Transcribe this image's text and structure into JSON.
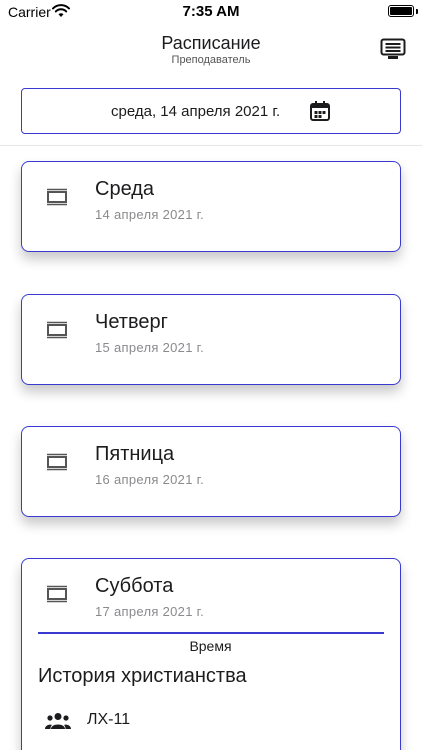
{
  "status_bar": {
    "carrier": "Carrier",
    "time": "7:35 AM"
  },
  "nav": {
    "title": "Расписание",
    "subtitle": "Преподаватель",
    "action_icon": "keyboard-icon"
  },
  "date_picker": {
    "value": "среда, 14 апреля 2021 г.",
    "icon": "calendar-icon"
  },
  "days": [
    {
      "name": "Среда",
      "date": "14 апреля 2021 г.",
      "icon": "collapse-icon"
    },
    {
      "name": "Четверг",
      "date": "15 апреля 2021 г.",
      "icon": "collapse-icon"
    },
    {
      "name": "Пятница",
      "date": "16 апреля 2021 г.",
      "icon": "collapse-icon"
    },
    {
      "name": "Суббота",
      "date": "17 апреля 2021 г.",
      "icon": "collapse-icon",
      "time_header": "Время",
      "lesson": {
        "title": "История христианства",
        "group_icon": "group-icon",
        "group": "ЛХ-11"
      }
    }
  ],
  "colors": {
    "accent": "#3a3ad0",
    "text": "#1c1c1e",
    "secondary_text": "#8a8a8e",
    "icon": "#555555"
  }
}
